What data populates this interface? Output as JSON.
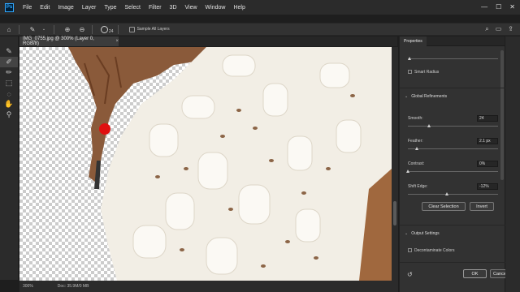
{
  "app": {
    "logo_text": "Ps"
  },
  "menu": [
    "File",
    "Edit",
    "Image",
    "Layer",
    "Type",
    "Select",
    "Filter",
    "3D",
    "View",
    "Window",
    "Help"
  ],
  "window_controls": {
    "minimize": "—",
    "maximize": "☐",
    "close": "✕"
  },
  "options_bar": {
    "brush_size": "24",
    "sample_all_layers": "Sample All Layers"
  },
  "document_tab": {
    "title": "IMG_0755.jpg @ 300% (Layer 0, RGB/8)",
    "close": "×"
  },
  "status_bar": {
    "zoom": "300%",
    "doc_info": "Doc: 35.9M/0 MB"
  },
  "properties": {
    "tab": "Properties",
    "smart_radius": "Smart Radius",
    "global_refinements": "Global Refinements",
    "smooth": {
      "label": "Smooth:",
      "value": "24",
      "level": 0.24
    },
    "feather": {
      "label": "Feather:",
      "value": "2.1 px",
      "level": 0.1
    },
    "contrast": {
      "label": "Contrast:",
      "value": "0%",
      "level": 0.0
    },
    "shift_edge": {
      "label": "Shift Edge:",
      "value": "-12%",
      "level": 0.44
    },
    "clear_selection": "Clear Selection",
    "invert": "Invert",
    "output_settings": "Output Settings",
    "decontaminate": "Decontaminate Colors",
    "ok": "OK",
    "cancel": "Cancel"
  },
  "colors": {
    "accent": "#31a8ff",
    "marker": "#e01010",
    "sweater": "#f3efe6"
  },
  "icons": [
    "ps-logo-icon",
    "home-icon",
    "brush-icon",
    "add-icon",
    "subtract-icon",
    "search-icon",
    "panel-icon",
    "share-icon",
    "reset-icon"
  ]
}
